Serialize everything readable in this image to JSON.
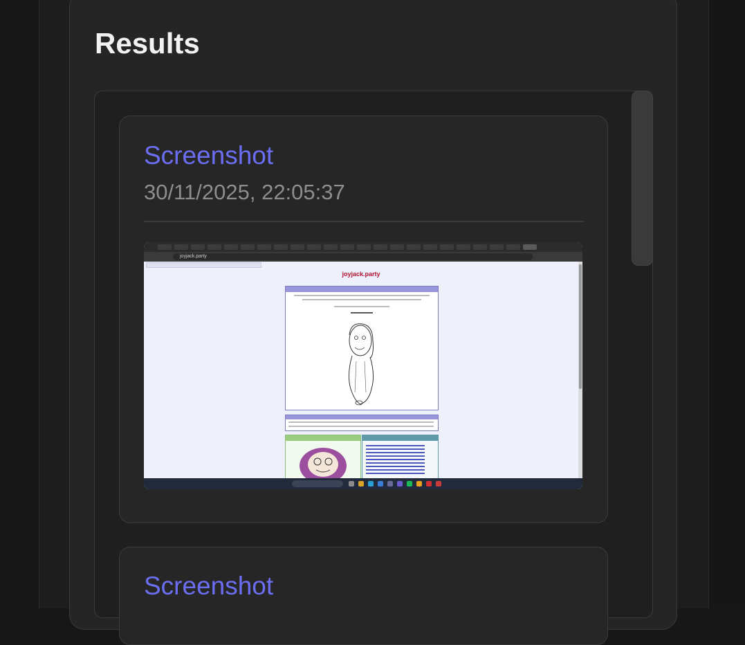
{
  "results": {
    "title": "Results"
  },
  "cards": [
    {
      "title": "Screenshot",
      "timestamp": "30/11/2025, 22:05:37",
      "thumbnail": {
        "address": "joyjack.party",
        "site_title": "joyjack.party"
      }
    },
    {
      "title": "Screenshot"
    }
  ],
  "colors": {
    "card_title": "#6b6ef2",
    "background": "#171717",
    "panel": "#252525"
  }
}
